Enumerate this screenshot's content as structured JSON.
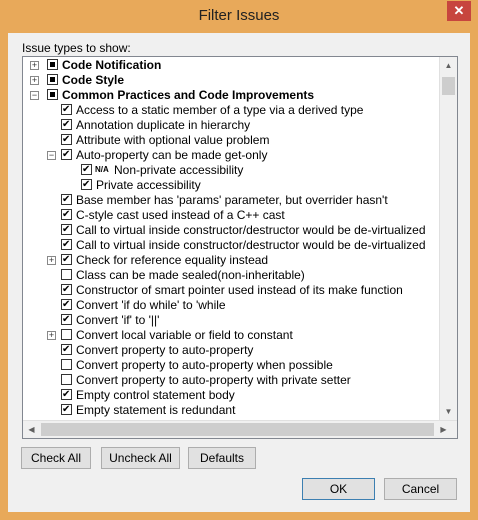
{
  "window": {
    "title": "Filter Issues",
    "close_glyph": "✕"
  },
  "label": "Issue types to show:",
  "tree": [
    {
      "level": 0,
      "text": "Code Notification",
      "state": "indeterminate",
      "expander": "+",
      "bold": true
    },
    {
      "level": 0,
      "text": "Code Style",
      "state": "indeterminate",
      "expander": "+",
      "bold": true
    },
    {
      "level": 0,
      "text": "Common Practices and Code Improvements",
      "state": "indeterminate",
      "expander": "−",
      "bold": true
    },
    {
      "level": 1,
      "text": "Access to a static member of a type via a derived type",
      "state": "checked"
    },
    {
      "level": 1,
      "text": "Annotation duplicate in hierarchy",
      "state": "checked"
    },
    {
      "level": 1,
      "text": "Attribute with optional value problem",
      "state": "checked"
    },
    {
      "level": 1,
      "text": "Auto-property can be made get-only",
      "state": "checked",
      "expander": "−"
    },
    {
      "level": 2,
      "text": "Non-private accessibility",
      "state": "checked",
      "badge": "N/A"
    },
    {
      "level": 2,
      "text": "Private accessibility",
      "state": "checked"
    },
    {
      "level": 1,
      "text": "Base member has 'params' parameter, but overrider hasn't",
      "state": "checked"
    },
    {
      "level": 1,
      "text": "C-style cast used instead of a C++ cast",
      "state": "checked"
    },
    {
      "level": 1,
      "text": "Call to virtual inside constructor/destructor would be de-virtualized",
      "state": "checked"
    },
    {
      "level": 1,
      "text": "Call to virtual inside constructor/destructor would be de-virtualized",
      "state": "checked"
    },
    {
      "level": 1,
      "text": "Check for reference equality instead",
      "state": "checked",
      "expander": "+"
    },
    {
      "level": 1,
      "text": "Class can be made sealed(non-inheritable)",
      "state": "unchecked"
    },
    {
      "level": 1,
      "text": "Constructor of smart pointer used instead of its make function",
      "state": "checked"
    },
    {
      "level": 1,
      "text": "Convert 'if do while' to 'while",
      "state": "checked"
    },
    {
      "level": 1,
      "text": "Convert 'if' to '||'",
      "state": "checked"
    },
    {
      "level": 1,
      "text": "Convert local variable or field to constant",
      "state": "unchecked",
      "expander": "+"
    },
    {
      "level": 1,
      "text": "Convert property to auto-property",
      "state": "checked"
    },
    {
      "level": 1,
      "text": "Convert property to auto-property when possible",
      "state": "unchecked"
    },
    {
      "level": 1,
      "text": "Convert property to auto-property with private setter",
      "state": "unchecked"
    },
    {
      "level": 1,
      "text": "Empty control statement body",
      "state": "checked"
    },
    {
      "level": 1,
      "text": "Empty statement is redundant",
      "state": "checked"
    }
  ],
  "scroll": {
    "up": "▲",
    "down": "▼",
    "left": "◀",
    "right": "▶"
  },
  "buttons": {
    "check_all": "Check All",
    "uncheck_all": "Uncheck All",
    "defaults": "Defaults",
    "ok": "OK",
    "cancel": "Cancel"
  }
}
